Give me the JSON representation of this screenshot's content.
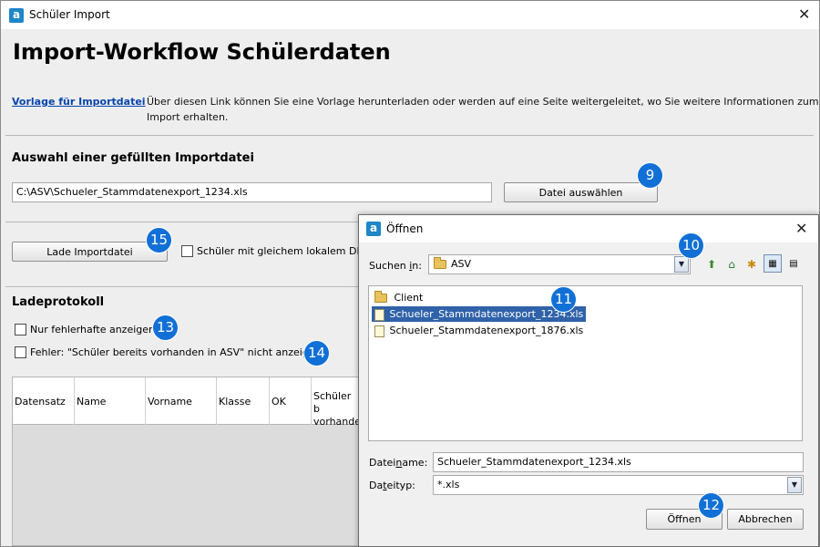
{
  "window": {
    "title": "Schüler Import",
    "app_icon_letter": "a",
    "close_glyph": "✕"
  },
  "page": {
    "heading": "Import-Workflow Schülerdaten",
    "template_link": "Vorlage für Importdatei",
    "template_desc_line1": "Über diesen Link können Sie eine Vorlage herunterladen oder werden auf eine Seite weitergeleitet, wo Sie weitere Informationen zum",
    "template_desc_line2": "Import erhalten."
  },
  "file_select": {
    "section_title": "Auswahl einer gefüllten Importdatei",
    "path_value": "C:\\ASV\\Schueler_Stammdatenexport_1234.xls",
    "choose_button": "Datei auswählen"
  },
  "load": {
    "load_button": "Lade Importdatei",
    "same_dm_checkbox_label": "Schüler mit gleichem lokalem DM a"
  },
  "protocol": {
    "section_title": "Ladeprotokoll",
    "only_errors_label": "Nur fehlerhafte anzeigen",
    "hide_existing_label": "Fehler: \"Schüler bereits vorhanden in ASV\" nicht anzeigen",
    "columns": [
      "Datensatz",
      "Name",
      "Vorname",
      "Klasse",
      "OK",
      "Schüler b",
      "vorhande"
    ]
  },
  "badges": {
    "b9": "9",
    "b10": "10",
    "b11": "11",
    "b12": "12",
    "b13": "13",
    "b14": "14",
    "b15": "15"
  },
  "dialog": {
    "title": "Öffnen",
    "look_in_label_pre": "Suchen ",
    "look_in_label_ul": "i",
    "look_in_label_post": "n:",
    "look_in_value": "ASV",
    "files": [
      {
        "name": "Client",
        "type": "folder"
      },
      {
        "name": "Schueler_Stammdatenexport_1234.xls",
        "type": "file"
      },
      {
        "name": "Schueler_Stammdatenexport_1876.xls",
        "type": "file"
      }
    ],
    "filename_label_pre": "Datei",
    "filename_label_ul": "n",
    "filename_label_post": "ame:",
    "filename_value": "Schueler_Stammdatenexport_1234.xls",
    "filetype_label_pre": "Da",
    "filetype_label_ul": "t",
    "filetype_label_post": "eityp:",
    "filetype_value": "*.xls",
    "open_button": "Öffnen",
    "cancel_button": "Abbrechen"
  },
  "colors": {
    "badge": "#1170d6",
    "link": "#0645ad",
    "selection": "#2f62a8"
  }
}
